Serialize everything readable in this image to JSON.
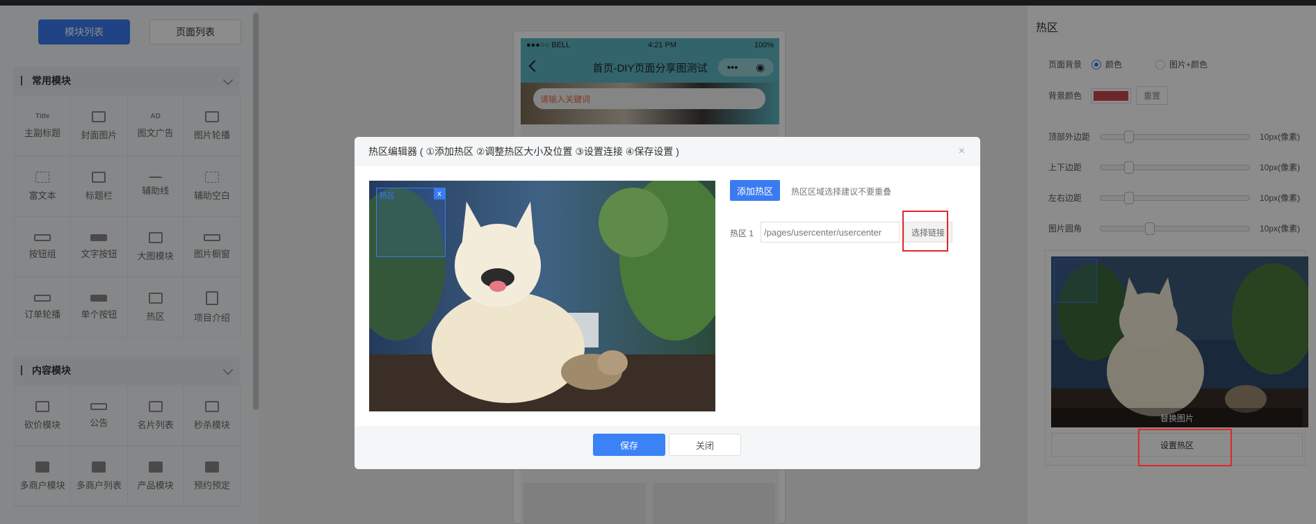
{
  "left_panel": {
    "tabs": [
      "模块列表",
      "页面列表"
    ],
    "group_common": "常用模块",
    "common_items": [
      "主副标题",
      "封面图片",
      "图文广告",
      "图片轮播",
      "富文本",
      "标题栏",
      "辅助线",
      "辅助空白",
      "按钮组",
      "文字按钮",
      "大图模块",
      "图片橱窗",
      "订单轮播",
      "单个按钮",
      "热区",
      "项目介绍"
    ],
    "group_content": "内容模块",
    "content_items": [
      "砍价模块",
      "公告",
      "名片列表",
      "秒杀模块",
      "多商户模块",
      "多商户列表",
      "产品模块",
      "预约预定"
    ]
  },
  "phone": {
    "carrier": "●●●○○ BELL",
    "time": "4:21 PM",
    "battery": "100%",
    "page_title": "首页-DIY页面分享图测试",
    "search_placeholder": "请输入关键词"
  },
  "right_panel": {
    "title": "热区",
    "bg_label": "页面背景",
    "bg_opt1": "颜色",
    "bg_opt2": "图片+颜色",
    "bgcolor_label": "背景颜色",
    "bgcolor_value": "#c8484b",
    "reset": "重置",
    "sliders": [
      {
        "label": "顶部外边距",
        "value": "10px(像素)",
        "level": 0.1
      },
      {
        "label": "上下边距",
        "value": "10px(像素)",
        "level": 0.1
      },
      {
        "label": "左右边距",
        "value": "10px(像素)",
        "level": 0.1
      },
      {
        "label": "图片圆角",
        "value": "10px(像素)",
        "level": 0.28
      }
    ],
    "replace_image": "替换图片",
    "set_hotarea": "设置热区"
  },
  "modal": {
    "title": "热区编辑器 ( ①添加热区 ②调整热区大小及位置 ③设置连接 ④保存设置 )",
    "close": "×",
    "hotarea_tag": "热区",
    "hotarea_close": "x",
    "add_button": "添加热区",
    "tip": "热区区域选择建议不要重叠",
    "area_label": "热区 1",
    "area_link": "/pages/usercenter/usercenter",
    "choose_link": "选择链接",
    "save": "保存",
    "close_btn": "关闭"
  },
  "colors": {
    "accent": "#3a7bf0",
    "highlight": "#e0262b"
  }
}
